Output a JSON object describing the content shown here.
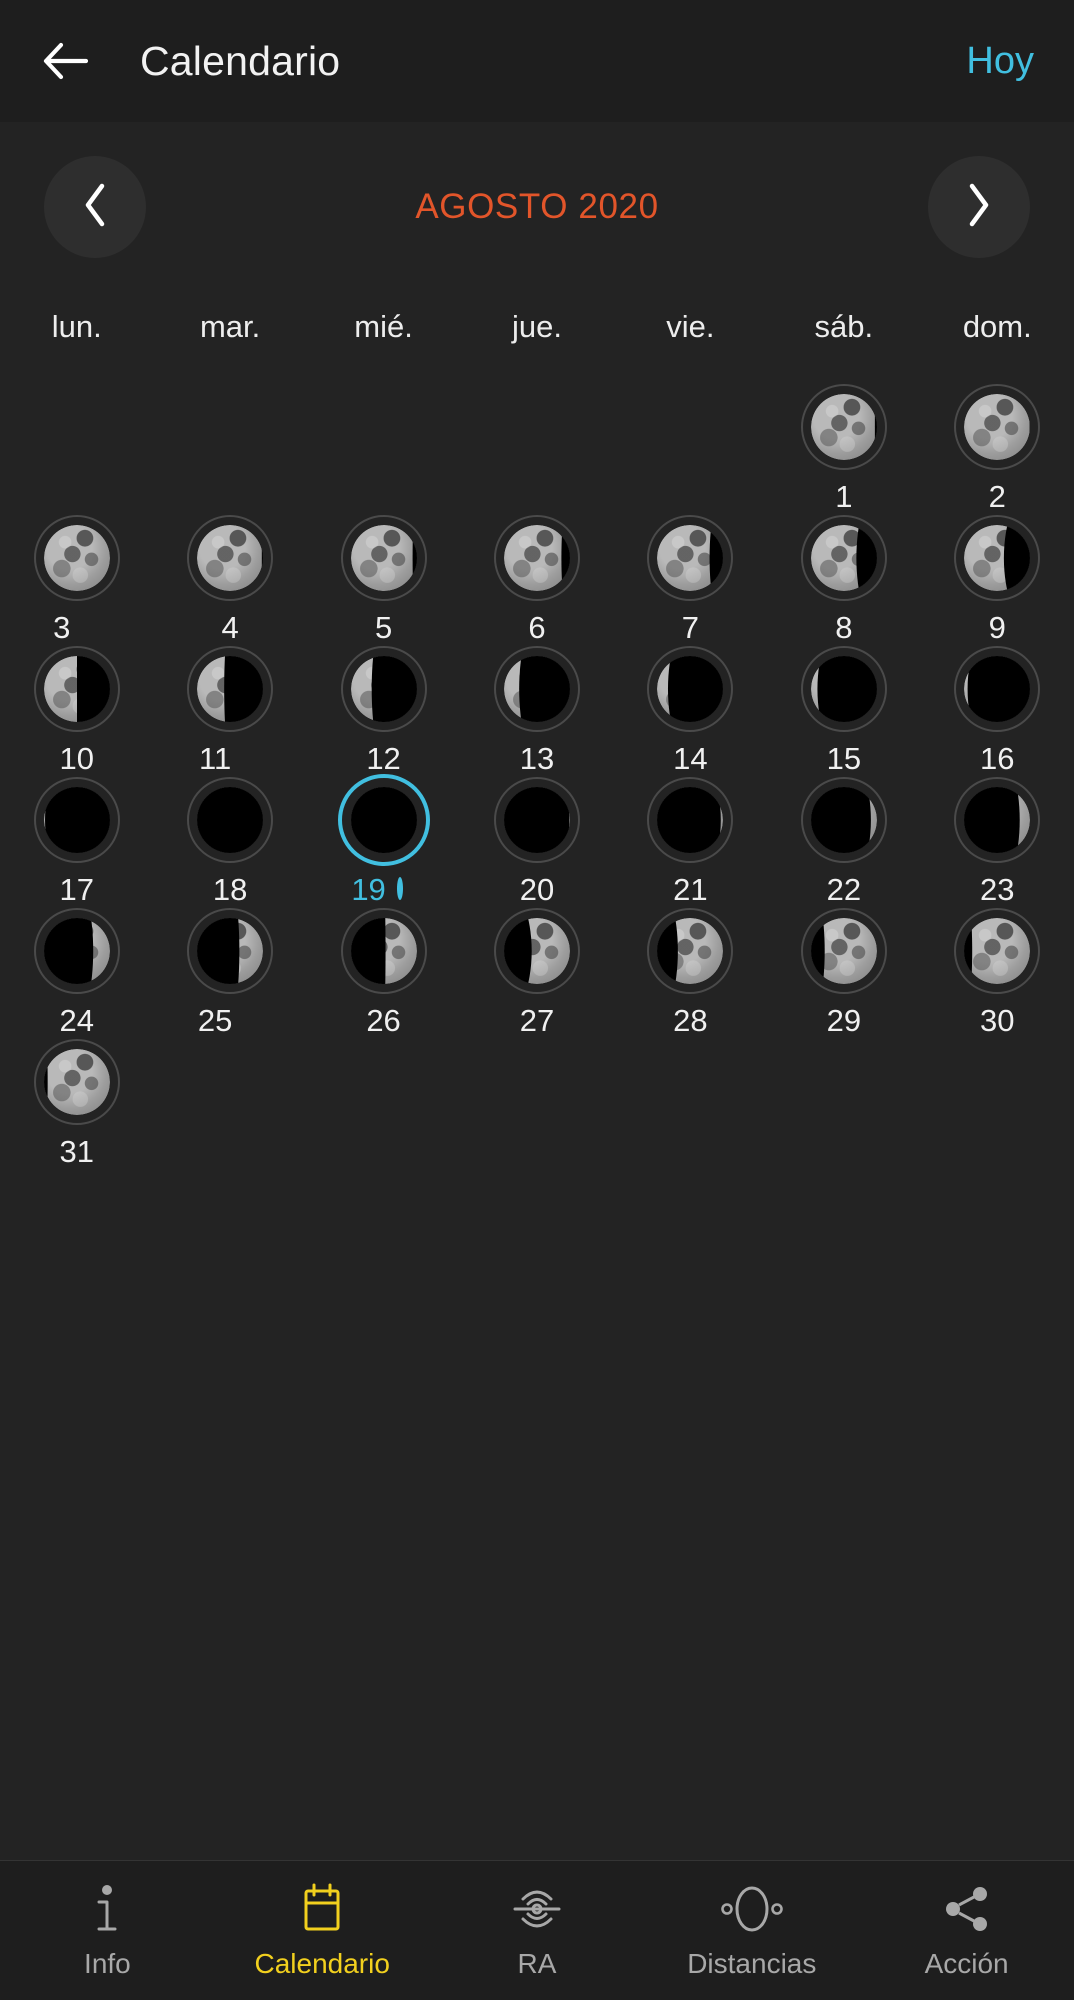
{
  "header": {
    "back_icon": "arrow-left-icon",
    "title": "Calendario",
    "today_label": "Hoy",
    "today_color": "#41bfe0"
  },
  "month_nav": {
    "prev_icon": "chevron-left-icon",
    "next_icon": "chevron-right-icon",
    "month_label": "AGOSTO 2020",
    "month_color": "#e2552a"
  },
  "weekdays": [
    "lun.",
    "mar.",
    "mié.",
    "jue.",
    "vie.",
    "sáb.",
    "dom."
  ],
  "calendar": {
    "month": "AGOSTO",
    "year": "2020",
    "leading_blanks": 5,
    "selected_day": "19",
    "selection_color": "#41bfe0",
    "days": [
      {
        "num": "1",
        "illumination": 0.97,
        "waxing": false,
        "marker": null
      },
      {
        "num": "2",
        "illumination": 0.99,
        "waxing": false,
        "marker": null
      },
      {
        "num": "3",
        "illumination": 1.0,
        "waxing": false,
        "marker": "full"
      },
      {
        "num": "4",
        "illumination": 0.98,
        "waxing": false,
        "marker": null
      },
      {
        "num": "5",
        "illumination": 0.94,
        "waxing": false,
        "marker": null
      },
      {
        "num": "6",
        "illumination": 0.87,
        "waxing": false,
        "marker": null
      },
      {
        "num": "7",
        "illumination": 0.79,
        "waxing": false,
        "marker": null
      },
      {
        "num": "8",
        "illumination": 0.69,
        "waxing": false,
        "marker": null
      },
      {
        "num": "9",
        "illumination": 0.6,
        "waxing": false,
        "marker": null
      },
      {
        "num": "10",
        "illumination": 0.5,
        "waxing": false,
        "marker": null
      },
      {
        "num": "11",
        "illumination": 0.41,
        "waxing": false,
        "marker": "last_quarter"
      },
      {
        "num": "12",
        "illumination": 0.32,
        "waxing": false,
        "marker": null
      },
      {
        "num": "13",
        "illumination": 0.23,
        "waxing": false,
        "marker": null
      },
      {
        "num": "14",
        "illumination": 0.16,
        "waxing": false,
        "marker": null
      },
      {
        "num": "15",
        "illumination": 0.1,
        "waxing": false,
        "marker": null
      },
      {
        "num": "16",
        "illumination": 0.05,
        "waxing": false,
        "marker": null
      },
      {
        "num": "17",
        "illumination": 0.02,
        "waxing": false,
        "marker": null
      },
      {
        "num": "18",
        "illumination": 0.0,
        "waxing": true,
        "marker": null
      },
      {
        "num": "19",
        "illumination": 0.0,
        "waxing": true,
        "marker": "new"
      },
      {
        "num": "20",
        "illumination": 0.01,
        "waxing": true,
        "marker": null
      },
      {
        "num": "21",
        "illumination": 0.04,
        "waxing": true,
        "marker": null
      },
      {
        "num": "22",
        "illumination": 0.09,
        "waxing": true,
        "marker": null
      },
      {
        "num": "23",
        "illumination": 0.16,
        "waxing": true,
        "marker": null
      },
      {
        "num": "24",
        "illumination": 0.25,
        "waxing": true,
        "marker": null
      },
      {
        "num": "25",
        "illumination": 0.36,
        "waxing": true,
        "marker": "first_quarter"
      },
      {
        "num": "26",
        "illumination": 0.47,
        "waxing": true,
        "marker": null
      },
      {
        "num": "27",
        "illumination": 0.58,
        "waxing": true,
        "marker": null
      },
      {
        "num": "28",
        "illumination": 0.69,
        "waxing": true,
        "marker": null
      },
      {
        "num": "29",
        "illumination": 0.79,
        "waxing": true,
        "marker": null
      },
      {
        "num": "30",
        "illumination": 0.88,
        "waxing": true,
        "marker": null
      },
      {
        "num": "31",
        "illumination": 0.94,
        "waxing": true,
        "marker": null
      }
    ]
  },
  "bottom_nav": {
    "active_index": 1,
    "active_color": "#f2d01e",
    "items": [
      {
        "label": "Info",
        "icon": "info-icon"
      },
      {
        "label": "Calendario",
        "icon": "calendar-icon"
      },
      {
        "label": "RA",
        "icon": "ar-waves-icon"
      },
      {
        "label": "Distancias",
        "icon": "orbit-distance-icon"
      },
      {
        "label": "Acción",
        "icon": "share-icon"
      }
    ]
  }
}
